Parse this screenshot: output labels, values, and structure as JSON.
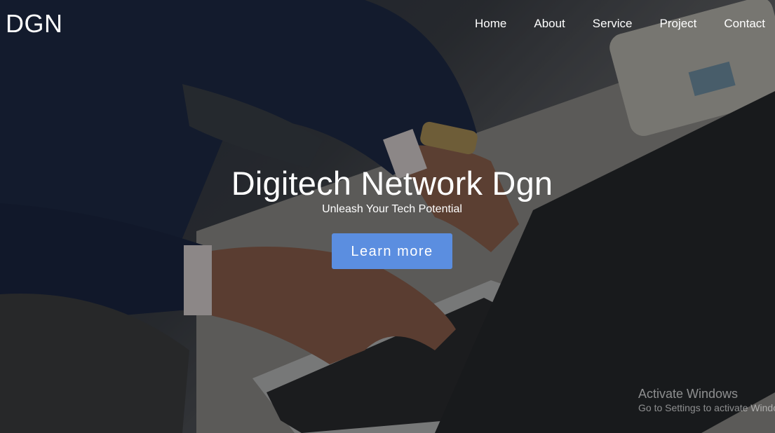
{
  "header": {
    "logo": "DGN",
    "nav": [
      {
        "label": "Home"
      },
      {
        "label": "About"
      },
      {
        "label": "Service"
      },
      {
        "label": "Project"
      },
      {
        "label": "Contact"
      }
    ]
  },
  "hero": {
    "title": "Digitech Network Dgn",
    "subtitle": "Unleash Your Tech Potential",
    "cta_label": "Learn more",
    "cta_color": "#5b8ee0"
  },
  "watermark": {
    "title": "Activate Windows",
    "subtitle": "Go to Settings to activate Windows."
  }
}
